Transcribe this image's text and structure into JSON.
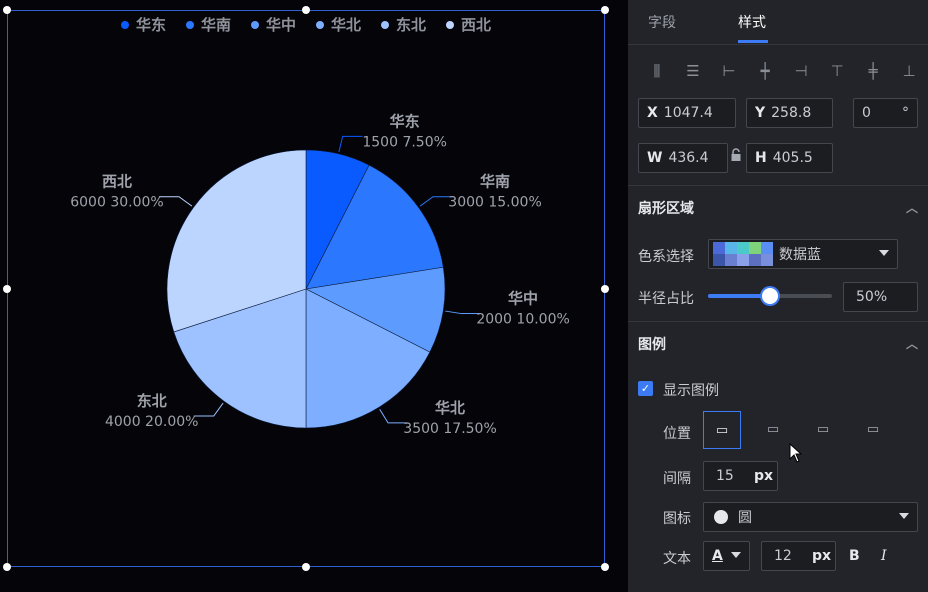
{
  "legend": [
    {
      "name": "华东",
      "color": "#0a5bff"
    },
    {
      "name": "华南",
      "color": "#2b78ff"
    },
    {
      "name": "华中",
      "color": "#5d9bff"
    },
    {
      "name": "华北",
      "color": "#7eaeff"
    },
    {
      "name": "东北",
      "color": "#9dc2ff"
    },
    {
      "name": "西北",
      "color": "#bcd5ff"
    }
  ],
  "chart_data": {
    "type": "pie",
    "categories": [
      "华东",
      "华南",
      "华中",
      "华北",
      "东北",
      "西北"
    ],
    "values": [
      1500,
      3000,
      2000,
      3500,
      4000,
      6000
    ],
    "percentages": [
      "7.50%",
      "15.00%",
      "10.00%",
      "17.50%",
      "20.00%",
      "30.00%"
    ],
    "colors": [
      "#0a5bff",
      "#2b78ff",
      "#5d9bff",
      "#7eaeff",
      "#9dc2ff",
      "#bcd5ff"
    ],
    "legend_position": "top-center",
    "labels": [
      {
        "name": "华东",
        "value": "1500 7.50%"
      },
      {
        "name": "华南",
        "value": "3000 15.00%"
      },
      {
        "name": "华中",
        "value": "2000 10.00%"
      },
      {
        "name": "华北",
        "value": "3500 17.50%"
      },
      {
        "name": "东北",
        "value": "4000 20.00%"
      },
      {
        "name": "西北",
        "value": "6000 30.00%"
      }
    ]
  },
  "panel": {
    "tabs": [
      "字段",
      "样式"
    ],
    "active_tab": "样式",
    "align_icons": [
      "distribute-horizontal-icon",
      "distribute-vertical-icon",
      "align-left-icon",
      "align-center-horizontal-icon",
      "align-right-icon",
      "align-top-icon",
      "align-middle-vertical-icon",
      "align-bottom-icon"
    ],
    "x_label": "X",
    "x_value": "1047.4",
    "y_label": "Y",
    "y_value": "258.8",
    "rotation_value": "0",
    "rotation_unit": "°",
    "w_label": "W",
    "w_value": "436.4",
    "h_label": "H",
    "h_value": "405.5",
    "sector_section": "扇形区域",
    "color_scheme_label": "色系选择",
    "color_scheme_value": "数据蓝",
    "radius_label": "半径占比",
    "radius_value": "50%",
    "radius_fraction": 0.5,
    "legend_section": "图例",
    "show_legend_label": "显示图例",
    "show_legend_checked": true,
    "position_label": "位置",
    "spacing_label": "间隔",
    "spacing_value": "15",
    "spacing_unit": "px",
    "icon_label": "图标",
    "icon_value": "圆",
    "text_label": "文本",
    "text_color_glyph": "A",
    "font_size_value": "12",
    "font_size_unit": "px",
    "bold_label": "B",
    "italic_label": "I"
  }
}
